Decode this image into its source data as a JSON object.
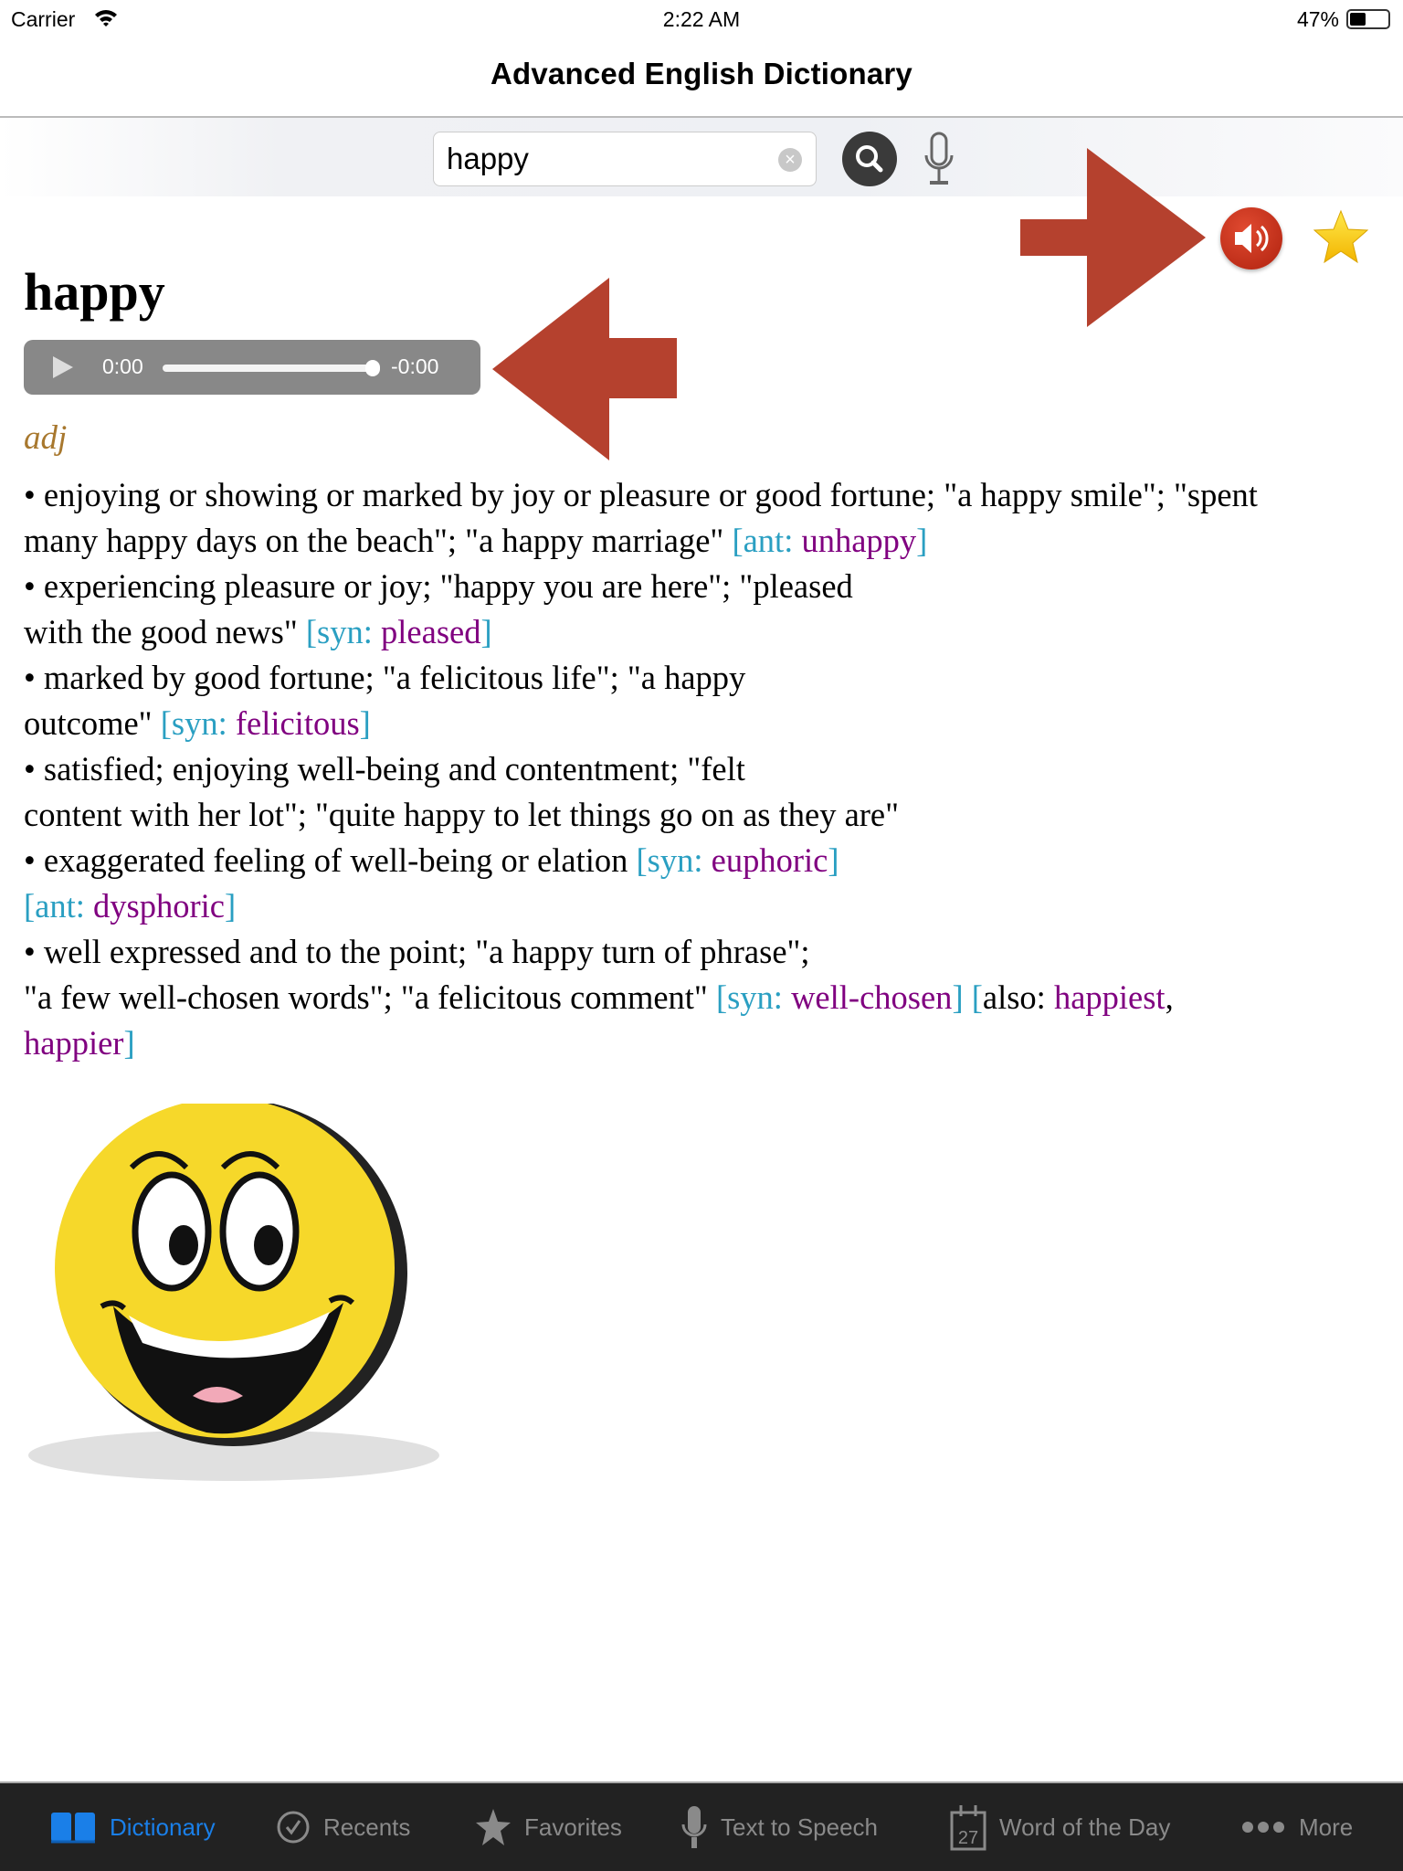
{
  "status": {
    "carrier": "Carrier",
    "time": "2:22 AM",
    "battery": "47%",
    "battery_level": 0.47
  },
  "nav": {
    "title": "Advanced English Dictionary"
  },
  "search": {
    "value": "happy",
    "placeholder": ""
  },
  "entry": {
    "word": "happy",
    "player": {
      "current": "0:00",
      "remaining": "-0:00",
      "progress": 1.0
    },
    "pos": "adj",
    "lines": [
      [
        [
          "• enjoying or showing or marked by joy or pleasure or good fortune; \"a happy smile\"; \"spent",
          "n"
        ]
      ],
      [
        [
          "many happy days on the beach\"; \"a happy marriage\" ",
          "n"
        ],
        [
          "[ant: ",
          "b"
        ],
        [
          "unhappy",
          "w"
        ],
        [
          "]",
          "b"
        ]
      ],
      [
        [
          "• experiencing pleasure or joy; \"happy you are here\"; \"pleased",
          "n"
        ]
      ],
      [
        [
          "with the good news\" ",
          "n"
        ],
        [
          "[syn: ",
          "b"
        ],
        [
          "pleased",
          "w"
        ],
        [
          "]",
          "b"
        ]
      ],
      [
        [
          "• marked by good fortune; \"a felicitous life\"; \"a happy",
          "n"
        ]
      ],
      [
        [
          "outcome\" ",
          "n"
        ],
        [
          "[syn: ",
          "b"
        ],
        [
          "felicitous",
          "w"
        ],
        [
          "]",
          "b"
        ]
      ],
      [
        [
          "• satisfied; enjoying well-being and contentment; \"felt",
          "n"
        ]
      ],
      [
        [
          "content with her lot\"; \"quite happy to let things go on as they are\"",
          "n"
        ]
      ],
      [
        [
          "• exaggerated feeling of well-being or elation ",
          "n"
        ],
        [
          "[syn: ",
          "b"
        ],
        [
          "euphoric",
          "w"
        ],
        [
          "]",
          "b"
        ]
      ],
      [
        [
          "[ant: ",
          "b"
        ],
        [
          "dysphoric",
          "w"
        ],
        [
          "]",
          "b"
        ]
      ],
      [
        [
          "• well expressed and to the point; \"a happy turn of phrase\";",
          "n"
        ]
      ],
      [
        [
          "\"a few well-chosen words\"; \"a felicitous comment\" ",
          "n"
        ],
        [
          "[syn: ",
          "b"
        ],
        [
          "well-chosen",
          "w"
        ],
        [
          "] [",
          "b"
        ],
        [
          "also: ",
          "n"
        ],
        [
          "happiest",
          "w"
        ],
        [
          ",",
          "n"
        ]
      ],
      [
        [
          "happier",
          "w"
        ],
        [
          "]",
          "b"
        ]
      ]
    ]
  },
  "tabs": [
    {
      "label": "Dictionary",
      "icon": "book-icon",
      "active": true
    },
    {
      "label": "Recents",
      "icon": "clock-check-icon"
    },
    {
      "label": "Favorites",
      "icon": "star-icon"
    },
    {
      "label": "Text to Speech",
      "icon": "microphone-icon"
    },
    {
      "label": "Word of the Day",
      "icon": "calendar-icon",
      "icon_text": "27"
    },
    {
      "label": "More",
      "icon": "more-dots-icon"
    }
  ],
  "colors": {
    "accent": "#1a7fe8",
    "arrow": "#b5412e",
    "link_bracket": "#2a9fc2",
    "link_word": "#800080",
    "pos": "#a8782e"
  }
}
